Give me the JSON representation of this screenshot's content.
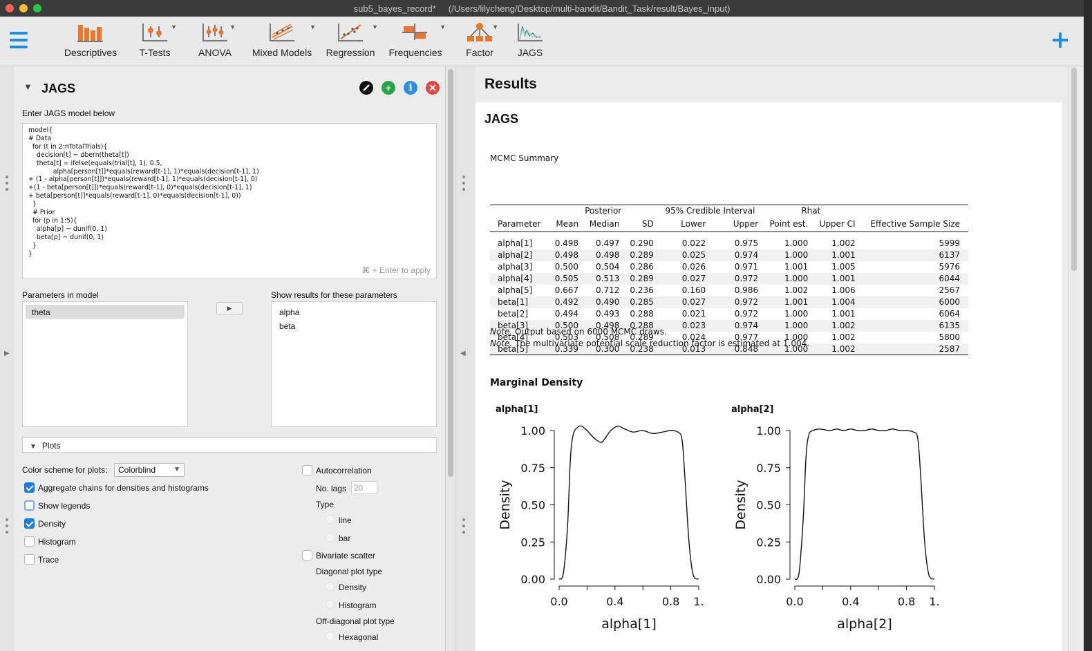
{
  "window": {
    "title": "sub5_bayes_record*",
    "path": "(/Users/lilycheng/Desktop/multi-bandit/Bandit_Task/result/Bayes_input)"
  },
  "toolbar": {
    "items": [
      {
        "label": "Descriptives",
        "icon": "descriptives-icon"
      },
      {
        "label": "T-Tests",
        "icon": "ttests-icon"
      },
      {
        "label": "ANOVA",
        "icon": "anova-icon"
      },
      {
        "label": "Mixed Models",
        "icon": "mixed-models-icon"
      },
      {
        "label": "Regression",
        "icon": "regression-icon"
      },
      {
        "label": "Frequencies",
        "icon": "frequencies-icon"
      },
      {
        "label": "Factor",
        "icon": "factor-icon"
      },
      {
        "label": "JAGS",
        "icon": "jags-icon"
      }
    ],
    "accent": "#1a8ee0"
  },
  "analysis": {
    "title": "JAGS",
    "model_label": "Enter JAGS model below",
    "model_code": "model{\n# Data\n  for (t in 2:nTotalTrials){\n    decision[t] ~ dbern(theta[t])\n    theta[t] = ifelse(equals(trial[t], 1), 0.5,\n            alpha[person[t]]*equals(reward[t-1], 1)*equals(decision[t-1], 1)\n+ (1 - alpha[person[t]])*equals(reward[t-1], 1)*equals(decision[t-1], 0)\n+(1 - beta[person[t]])*equals(reward[t-1], 0)*equals(decision[t-1], 1)\n+ beta[person[t]]*equals(reward[t-1], 0)*equals(decision[t-1], 0))\n  }\n  # Prior\n  for (p in 1:5){\n    alpha[p] ~ dunif(0, 1)\n    beta[p] ~ dunif(0, 1)\n  }\n}",
    "model_hint": "⌘ + Enter to apply",
    "params_label": "Parameters in model",
    "params": [
      "theta"
    ],
    "show_label": "Show results for these parameters",
    "show": [
      "alpha",
      "beta"
    ],
    "plots_header": "Plots",
    "color_label": "Color scheme for plots:",
    "color_value": "Colorblind",
    "options": {
      "aggregate": "Aggregate chains for densities and histograms",
      "legends": "Show legends",
      "density": "Density",
      "histogram": "Histogram",
      "trace": "Trace",
      "autocorrelation": "Autocorrelation",
      "lags_label": "No. lags",
      "lags_value": "20",
      "type_label": "Type",
      "type_line": "line",
      "type_bar": "bar",
      "bivariate": "Bivariate scatter",
      "diag_label": "Diagonal plot type",
      "diag_density": "Density",
      "diag_histogram": "Histogram",
      "offdiag_label": "Off-diagonal plot type",
      "offdiag_hex": "Hexagonal"
    }
  },
  "results": {
    "heading": "Results",
    "section": "JAGS",
    "table_title": "MCMC Summary",
    "group_headers": [
      "Posterior",
      "95% Credible Interval",
      "Rhat"
    ],
    "columns": [
      "Parameter",
      "Mean",
      "Median",
      "SD",
      "Lower",
      "Upper",
      "Point est.",
      "Upper CI",
      "Effective Sample Size"
    ],
    "rows": [
      [
        "alpha[1]",
        "0.498",
        "0.497",
        "0.290",
        "0.022",
        "0.975",
        "1.000",
        "1.002",
        "5999"
      ],
      [
        "alpha[2]",
        "0.498",
        "0.498",
        "0.289",
        "0.025",
        "0.974",
        "1.000",
        "1.001",
        "6137"
      ],
      [
        "alpha[3]",
        "0.500",
        "0.504",
        "0.286",
        "0.026",
        "0.971",
        "1.001",
        "1.005",
        "5976"
      ],
      [
        "alpha[4]",
        "0.505",
        "0.513",
        "0.289",
        "0.027",
        "0.972",
        "1.000",
        "1.001",
        "6044"
      ],
      [
        "alpha[5]",
        "0.667",
        "0.712",
        "0.236",
        "0.160",
        "0.986",
        "1.002",
        "1.006",
        "2567"
      ],
      [
        "beta[1]",
        "0.492",
        "0.490",
        "0.285",
        "0.027",
        "0.972",
        "1.001",
        "1.004",
        "6000"
      ],
      [
        "beta[2]",
        "0.494",
        "0.493",
        "0.288",
        "0.021",
        "0.972",
        "1.000",
        "1.001",
        "6064"
      ],
      [
        "beta[3]",
        "0.500",
        "0.498",
        "0.288",
        "0.023",
        "0.974",
        "1.000",
        "1.002",
        "6135"
      ],
      [
        "beta[4]",
        "0.503",
        "0.508",
        "0.289",
        "0.024",
        "0.977",
        "1.000",
        "1.002",
        "5800"
      ],
      [
        "beta[5]",
        "0.339",
        "0.300",
        "0.238",
        "0.013",
        "0.848",
        "1.000",
        "1.002",
        "2587"
      ]
    ],
    "note1_label": "Note.",
    "note1_text": " Output based on 6000 MCMC draws.",
    "note2_label": "Note.",
    "note2_text": " The multivariate potential scale reduction factor is estimated at 1.004.",
    "density_title": "Marginal Density"
  },
  "chart_data": [
    {
      "type": "line",
      "title": "alpha[1]",
      "xlabel": "alpha[1]",
      "ylabel": "Density",
      "xlim": [
        0,
        1
      ],
      "ylim": [
        0,
        1
      ],
      "xticks": [
        "0.0",
        "0.4",
        "0.8",
        "1."
      ],
      "yticks": [
        "0.00",
        "0.25",
        "0.50",
        "0.75",
        "1.00"
      ],
      "x": [
        0.0,
        0.03,
        0.06,
        0.08,
        0.1,
        0.13,
        0.16,
        0.2,
        0.25,
        0.3,
        0.33,
        0.37,
        0.42,
        0.47,
        0.53,
        0.6,
        0.67,
        0.74,
        0.8,
        0.85,
        0.88,
        0.9,
        0.93,
        0.96,
        1.0
      ],
      "y": [
        0.0,
        0.04,
        0.35,
        0.8,
        0.97,
        1.02,
        1.03,
        1.0,
        0.95,
        0.92,
        0.95,
        1.0,
        1.03,
        1.01,
        0.99,
        1.0,
        0.98,
        0.99,
        1.0,
        0.99,
        0.94,
        0.7,
        0.25,
        0.03,
        0.0
      ]
    },
    {
      "type": "line",
      "title": "alpha[2]",
      "xlabel": "alpha[2]",
      "ylabel": "Density",
      "xlim": [
        0,
        1
      ],
      "ylim": [
        0,
        1
      ],
      "xticks": [
        "0.0",
        "0.4",
        "0.8",
        "1."
      ],
      "yticks": [
        "0.00",
        "0.25",
        "0.50",
        "0.75",
        "1.00"
      ],
      "x": [
        0.0,
        0.03,
        0.06,
        0.08,
        0.1,
        0.13,
        0.18,
        0.25,
        0.3,
        0.35,
        0.4,
        0.45,
        0.5,
        0.55,
        0.6,
        0.65,
        0.7,
        0.75,
        0.8,
        0.85,
        0.88,
        0.9,
        0.93,
        0.96,
        1.0
      ],
      "y": [
        0.0,
        0.04,
        0.4,
        0.82,
        0.97,
        1.0,
        1.01,
        1.0,
        1.01,
        1.0,
        1.01,
        1.0,
        1.0,
        1.01,
        1.0,
        1.0,
        1.01,
        1.0,
        1.0,
        0.99,
        0.95,
        0.72,
        0.25,
        0.03,
        0.0
      ]
    }
  ]
}
